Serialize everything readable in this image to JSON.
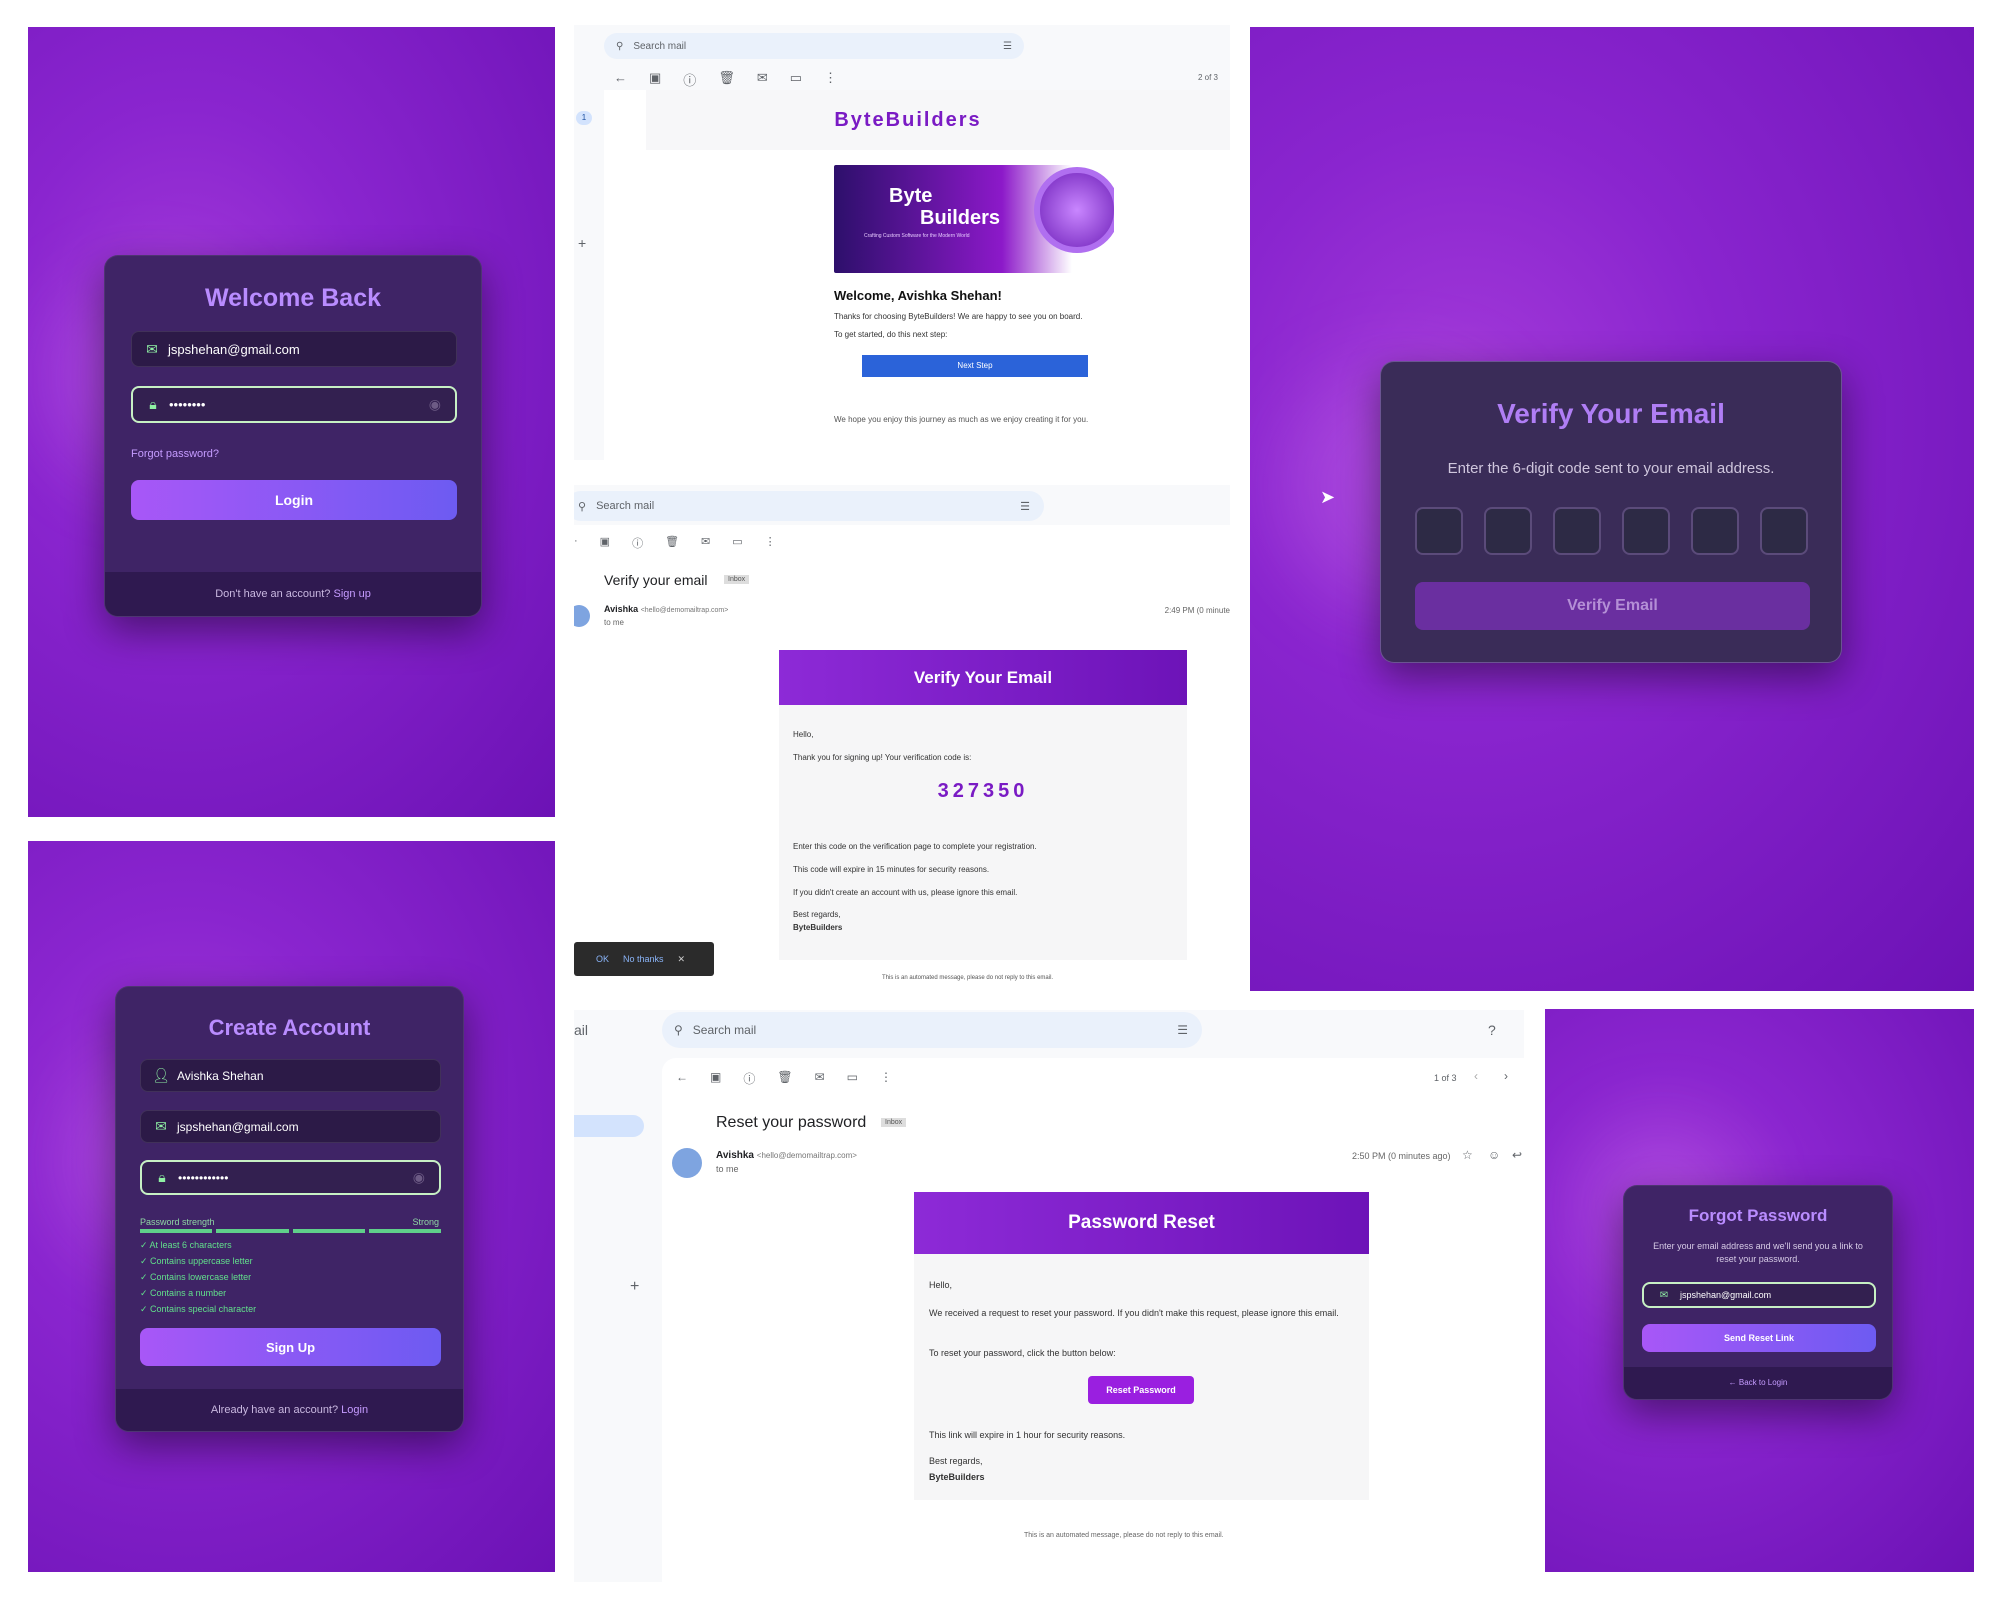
{
  "login": {
    "title": "Welcome Back",
    "email": "jspshehan@gmail.com",
    "password": "••••••••",
    "forgot": "Forgot password?",
    "button": "Login",
    "footer_text": "Don't have an account?",
    "footer_link": "Sign up"
  },
  "signup": {
    "title": "Create Account",
    "name": "Avishka Shehan",
    "email": "jspshehan@gmail.com",
    "password": "••••••••••••",
    "strength_label": "Password strength",
    "strength_value": "Strong",
    "strength_level": 1.0,
    "checks": [
      "At least 6 characters",
      "Contains uppercase letter",
      "Contains lowercase letter",
      "Contains a number",
      "Contains special character"
    ],
    "button": "Sign Up",
    "footer_text": "Already have an account?",
    "footer_link": "Login"
  },
  "welcome_mail": {
    "search": "Search mail",
    "counter": "2 of 3",
    "badge": "1",
    "brand": "ByteBuilders",
    "banner_line1": "Byte",
    "banner_line2": "Builders",
    "banner_tag": "Crafting Custom Software for the Modern World",
    "greeting": "Welcome, Avishka Shehan!",
    "line1": "Thanks for choosing ByteBuilders! We are happy to see you on board.",
    "line2": "To get started, do this next step:",
    "button": "Next Step",
    "closing": "We hope you enjoy this journey as much as we enjoy creating it for you."
  },
  "verify_mail": {
    "search": "Search mail",
    "subject": "Verify your email",
    "label": "Inbox",
    "sender": "Avishka",
    "sender_email": "<hello@demomailtrap.com>",
    "to": "to me",
    "time": "2:49 PM (0 minute",
    "header": "Verify Your Email",
    "hello": "Hello,",
    "thanks": "Thank you for signing up! Your verification code is:",
    "code": "327350",
    "l1": "Enter this code on the verification page to complete your registration.",
    "l2": "This code will expire in 15 minutes for security reasons.",
    "l3": "If you didn't create an account with us, please ignore this email.",
    "regards": "Best regards,",
    "company": "ByteBuilders",
    "auto": "This is an automated message, please do not reply to this email.",
    "toast_ok": "OK",
    "toast_no": "No thanks"
  },
  "verify_page": {
    "title": "Verify Your Email",
    "subtitle": "Enter the 6-digit code sent to your email address.",
    "button": "Verify Email"
  },
  "reset_mail": {
    "app": "ail",
    "search": "Search mail",
    "counter": "1 of 3",
    "subject": "Reset your password",
    "label": "Inbox",
    "sender": "Avishka",
    "sender_email": "<hello@demomailtrap.com>",
    "to": "to me",
    "time": "2:50 PM (0 minutes ago)",
    "header": "Password Reset",
    "hello": "Hello,",
    "l1": "We received a request to reset your password. If you didn't make this request, please ignore this email.",
    "l2": "To reset your password, click the button below:",
    "button": "Reset Password",
    "l3": "This link will expire in 1 hour for security reasons.",
    "regards": "Best regards,",
    "company": "ByteBuilders",
    "auto": "This is an automated message, please do not reply to this email."
  },
  "forgot": {
    "title": "Forgot Password",
    "subtitle": "Enter your email address and we'll send you a link to reset your password.",
    "email": "jspshehan@gmail.com",
    "button": "Send Reset Link",
    "back": "Back to Login"
  }
}
